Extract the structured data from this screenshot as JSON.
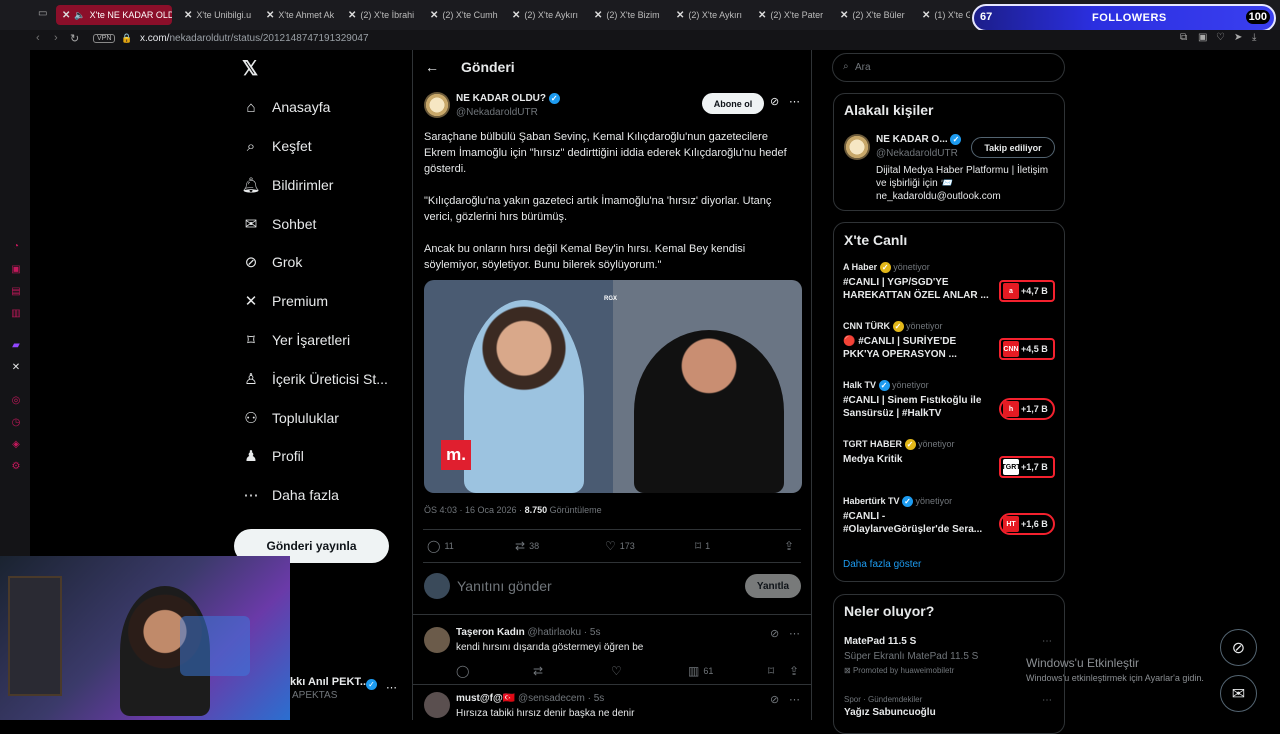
{
  "browser": {
    "tabs": [
      {
        "label": "X'te NE KADAR OLD",
        "active": true
      },
      {
        "label": "X'te Unibilgi.u"
      },
      {
        "label": "X'te Ahmet Ak"
      },
      {
        "label": "(2) X'te İbrahi"
      },
      {
        "label": "(2) X'te Cumh"
      },
      {
        "label": "(2) X'te Aykırı"
      },
      {
        "label": "(2) X'te Bizim"
      },
      {
        "label": "(2) X'te Aykırı"
      },
      {
        "label": "(2) X'te Pater"
      },
      {
        "label": "(2) X'te Büler"
      },
      {
        "label": "(1) X'te G"
      }
    ],
    "vpn": "VPN",
    "url_host": "x.com/",
    "url_path": "nekadaroldutr/status/2012148747191329047"
  },
  "followers_widget": {
    "count_left": "67",
    "label": "FOLLOWERS",
    "count_right": "100"
  },
  "nav": {
    "items": [
      {
        "label": "Anasayfa",
        "icon": "home-icon"
      },
      {
        "label": "Keşfet",
        "icon": "search-icon"
      },
      {
        "label": "Bildirimler",
        "icon": "bell-icon"
      },
      {
        "label": "Sohbet",
        "icon": "mail-icon"
      },
      {
        "label": "Grok",
        "icon": "grok-icon"
      },
      {
        "label": "Premium",
        "icon": "x-icon"
      },
      {
        "label": "Yer İşaretleri",
        "icon": "bookmark-icon"
      },
      {
        "label": "İçerik Üreticisi St...",
        "icon": "creator-icon"
      },
      {
        "label": "Topluluklar",
        "icon": "communities-icon"
      },
      {
        "label": "Profil",
        "icon": "profile-icon"
      },
      {
        "label": "Daha fazla",
        "icon": "more-icon"
      }
    ],
    "post_button": "Gönderi yayınla",
    "account_name": "kkı Anıl PEKT...",
    "account_handle": "APEKTAS"
  },
  "header": {
    "title": "Gönderi"
  },
  "tweet": {
    "name": "NE KADAR OLDU?",
    "handle": "@NekadaroldUTR",
    "subscribe": "Abone ol",
    "p1": "Saraçhane bülbülü Şaban Sevinç, Kemal Kılıçdaroğlu'nun gazetecilere Ekrem İmamoğlu için \"hırsız\"  dedirttiğini iddia ederek Kılıçdaroğlu'nu hedef gösterdi.",
    "p2": "\"Kılıçdaroğlu'na yakın gazeteci artık İmamoğlu'na 'hırsız' diyorlar. Utanç verici, gözlerini hırs bürümüş.",
    "p3": "Ancak bu onların hırsı değil Kemal Bey'in hırsı. Kemal Bey kendisi söylemiyor, söyletiyor. Bunu bilerek söylüyorum.\"",
    "video_watermark": "RGX",
    "video_logo": "m.",
    "time": "ÖS 4:03 · 16 Oca 2026 · ",
    "views": "8.750",
    "views_label": " Görüntüleme",
    "replies": "11",
    "retweets": "38",
    "likes": "173",
    "bookmarks": "1"
  },
  "reply_box": {
    "placeholder": "Yanıtını gönder",
    "button": "Yanıtla"
  },
  "replies": [
    {
      "name": "Taşeron Kadın",
      "handle": "@hatirlaoku · 5s",
      "text": "kendi hırsını dışarıda göstermeyi öğren be",
      "views": "61"
    },
    {
      "name": "must@f@🇹🇷",
      "handle": "@sensadecem · 5s",
      "text": "Hırsıza tabiki hırsız denir başka ne denir"
    }
  ],
  "search": {
    "placeholder": "Ara"
  },
  "related": {
    "title": "Alakalı kişiler",
    "name": "NE KADAR O...",
    "handle": "@NekadaroldUTR",
    "button": "Takip ediliyor",
    "bio1": "Dijital Medya Haber Platformu | İletişim",
    "bio2": "ve işbirliği için 📨",
    "bio3": "ne_kadaroldu@outlook.com"
  },
  "live": {
    "title": "X'te Canlı",
    "managed": "yönetiyor",
    "items": [
      {
        "source": "A Haber",
        "title": "#CANLI | YGP/SGD'YE HAREKATTAN ÖZEL ANLAR ...",
        "count": "+4,7 B",
        "logo": "a"
      },
      {
        "source": "CNN TÜRK",
        "title": "🔴 #CANLI | SURİYE'DE PKK'YA OPERASYON ...",
        "count": "+4,5 B",
        "logo": "CNN"
      },
      {
        "source": "Halk TV",
        "title": "#CANLI | Sinem Fıstıkoğlu ile Sansürsüz | #HalkTV",
        "count": "+1,7 B",
        "logo": "h"
      },
      {
        "source": "TGRT HABER",
        "title": "Medya Kritik",
        "count": "+1,7 B",
        "logo": "TGRT"
      },
      {
        "source": "Habertürk TV",
        "title": "#CANLI - #OlaylarveGörüşler'de Sera...",
        "count": "+1,6 B",
        "logo": "HT"
      }
    ],
    "more": "Daha fazla göster"
  },
  "happening": {
    "title": "Neler oluyor?",
    "item1_title": "MatePad 11.5 S",
    "item1_sub": "Süper Ekranlı MatePad 11.5 S",
    "item1_promo": "Promoted by huaweimobiletr",
    "item2_cat": "Spor · Gündemdekiler",
    "item2_title": "Yağız Sabuncuoğlu"
  },
  "windows": {
    "line1": "Windows'u Etkinleştir",
    "line2": "Windows'u etkinleştirmek için Ayarlar'a gidin."
  }
}
